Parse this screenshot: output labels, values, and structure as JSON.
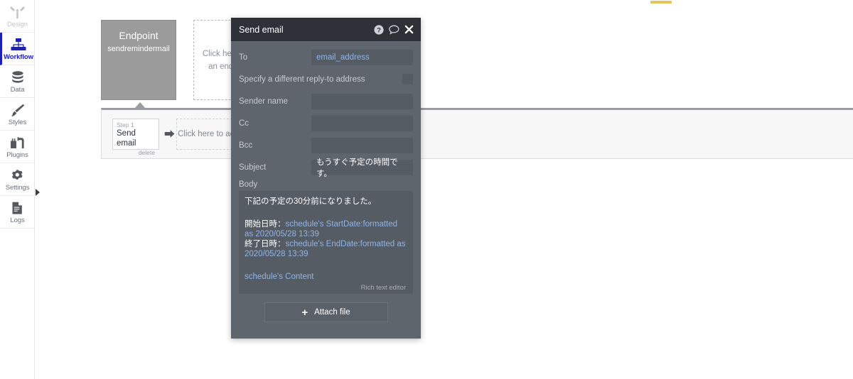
{
  "top_bar": {
    "accent_color": "#e3c65a"
  },
  "sidebar": {
    "items": [
      {
        "label": "Design",
        "icon": "design-tool-icon",
        "state": "disabled"
      },
      {
        "label": "Workflow",
        "icon": "workflow-icon",
        "state": "active"
      },
      {
        "label": "Data",
        "icon": "database-icon",
        "state": "normal"
      },
      {
        "label": "Styles",
        "icon": "paintbrush-icon",
        "state": "normal"
      },
      {
        "label": "Plugins",
        "icon": "plugins-icon",
        "state": "normal"
      },
      {
        "label": "Settings",
        "icon": "gear-icon",
        "state": "normal"
      },
      {
        "label": "Logs",
        "icon": "document-icon",
        "state": "normal"
      }
    ],
    "active_color": "#1e22aa"
  },
  "canvas": {
    "endpoint_card": {
      "title": "Endpoint",
      "subtitle": "sendremindermail"
    },
    "add_endpoint_placeholder": "Click here to add an endpoint...",
    "action_panel": {
      "step": {
        "number_label": "Step 1",
        "title": "Send email",
        "delete_label": "delete"
      },
      "arrow_glyph": "⮕",
      "add_action_placeholder": "Click here to add an action...",
      "close_glyph": "✖"
    }
  },
  "modal": {
    "title": "Send email",
    "header_icons": {
      "help": "help-circle-icon",
      "comment": "comment-bubble-icon",
      "close": "close-icon",
      "help_glyph": "?",
      "close_glyph": "✖"
    },
    "fields": {
      "to": {
        "label": "To",
        "value": "email_address",
        "value_type": "dynamic"
      },
      "reply_to": {
        "label": "Specify a different reply-to address",
        "checked": false
      },
      "sender_name": {
        "label": "Sender name",
        "value": ""
      },
      "cc": {
        "label": "Cc",
        "value": ""
      },
      "bcc": {
        "label": "Bcc",
        "value": ""
      },
      "subject": {
        "label": "Subject",
        "value": "もうすぐ予定の時間です。",
        "value_type": "plain"
      }
    },
    "body": {
      "label": "Body",
      "lines": [
        {
          "type": "plain",
          "text": "下記の予定の30分前になりました。"
        },
        {
          "type": "gap"
        },
        {
          "type": "mixed",
          "plain": "開始日時：",
          "dynamic": "schedule's StartDate:formatted as 2020/05/28 13:39"
        },
        {
          "type": "mixed",
          "plain": "終了日時：",
          "dynamic": "schedule's EndDate:formatted as 2020/05/28 13:39"
        },
        {
          "type": "gap"
        },
        {
          "type": "dynamic",
          "text": "schedule's Content"
        }
      ],
      "editor_note": "Rich text editor"
    },
    "attach_button": {
      "label": "Attach file",
      "plus_glyph": "+"
    }
  }
}
